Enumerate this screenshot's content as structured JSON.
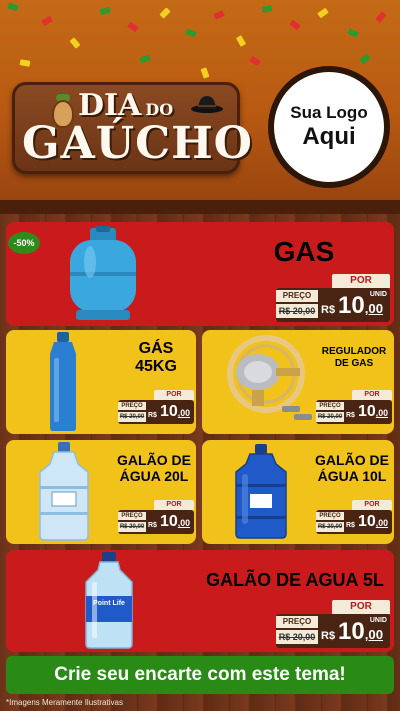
{
  "header": {
    "title_line1": "DIA",
    "title_do": "DO",
    "title_line2": "GAÚCHO",
    "logo_line1": "Sua Logo",
    "logo_line2": "Aqui"
  },
  "products": [
    {
      "name": "GAS",
      "discount_badge": "-50%",
      "por_label": "POR",
      "preco_label": "PREÇO",
      "old_price": "R$ 20,00",
      "currency": "R$",
      "price_int": "10",
      "price_cents": ",00",
      "unit": "UNID"
    },
    {
      "name_line1": "GÁS",
      "name_line2": "45KG",
      "por_label": "POR",
      "preco_label": "PREÇO",
      "old_price": "R$ 20,00",
      "currency": "R$",
      "price_int": "10",
      "price_cents": ",00",
      "unit": "UNID"
    },
    {
      "name_line1": "REGULADOR",
      "name_line2": "DE GAS",
      "por_label": "POR",
      "preco_label": "PREÇO",
      "old_price": "R$ 20,00",
      "currency": "R$",
      "price_int": "10",
      "price_cents": ",00",
      "unit": "UNID"
    },
    {
      "name_line1": "GALÃO DE",
      "name_line2": "ÁGUA 20L",
      "por_label": "POR",
      "preco_label": "PREÇO",
      "old_price": "R$ 20,00",
      "currency": "R$",
      "price_int": "10",
      "price_cents": ",00",
      "unit": "UNID"
    },
    {
      "name_line1": "GALÃO DE",
      "name_line2": "ÁGUA 10L",
      "por_label": "POR",
      "preco_label": "PREÇO",
      "old_price": "R$ 20,00",
      "currency": "R$",
      "price_int": "10",
      "price_cents": ",00",
      "unit": "UNID"
    },
    {
      "name": "GALÃO DE AGUA 5L",
      "por_label": "POR",
      "preco_label": "PREÇO",
      "old_price": "R$ 20,00",
      "currency": "R$",
      "price_int": "10",
      "price_cents": ",00",
      "unit": "UNID",
      "bottle_brand": "Point Life"
    }
  ],
  "cta": "Crie seu encarte com este tema!",
  "footnote": "*Imagens Meramente Ilustrativas",
  "colors": {
    "red_card": "#c91b1b",
    "yellow_card": "#f1c21a",
    "cta_green": "#2a8a16",
    "price_brown": "#4a2412"
  },
  "icons": [
    "gas-cylinder-icon",
    "gourd-icon",
    "hat-icon",
    "bottle-icon",
    "regulator-icon",
    "water-jug-icon"
  ]
}
